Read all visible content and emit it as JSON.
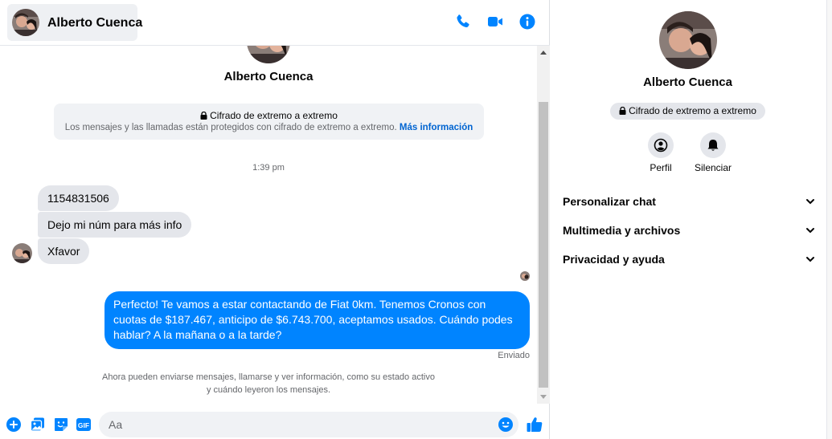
{
  "colors": {
    "accent": "#0084ff",
    "link": "#0064d1",
    "bubble_in": "#e4e6eb",
    "muted": "#65676b"
  },
  "header": {
    "contact_name": "Alberto Cuenca",
    "actions": [
      {
        "icon": "phone-icon"
      },
      {
        "icon": "video-camera-icon"
      },
      {
        "icon": "info-icon"
      }
    ]
  },
  "conversation": {
    "contact_name": "Alberto Cuenca",
    "encryption": {
      "title": "Cifrado de extremo a extremo",
      "description": "Los mensajes y las llamadas están protegidos con cifrado de extremo a extremo.",
      "link": "Más información"
    },
    "timestamp": "1:39 pm",
    "incoming": [
      "1154831506",
      "Dejo mi núm para más info",
      "Xfavor"
    ],
    "outgoing": "Perfecto! Te vamos a estar contactando de Fiat 0km. Tenemos Cronos con cuotas de $187.467, anticipo de $6.743.700, aceptamos usados. Cuándo podes hablar? A la mañana o a la tarde?",
    "status": "Enviado",
    "info_line1": "Ahora pueden enviarse mensajes, llamarse y ver información, como su estado activo",
    "info_line2": "y cuándo leyeron los mensajes."
  },
  "composer": {
    "placeholder": "Aa",
    "buttons": [
      "plus-circle-icon",
      "photo-icon",
      "sticker-icon",
      "gif-icon",
      "emoji-icon",
      "thumbs-up-icon"
    ],
    "gif_label": "GIF"
  },
  "panel": {
    "contact_name": "Alberto Cuenca",
    "badge": "Cifrado de extremo a extremo",
    "actions": [
      {
        "label": "Perfil",
        "icon": "profile-icon"
      },
      {
        "label": "Silenciar",
        "icon": "bell-icon"
      }
    ],
    "sections": [
      "Personalizar chat",
      "Multimedia y archivos",
      "Privacidad y ayuda"
    ]
  }
}
